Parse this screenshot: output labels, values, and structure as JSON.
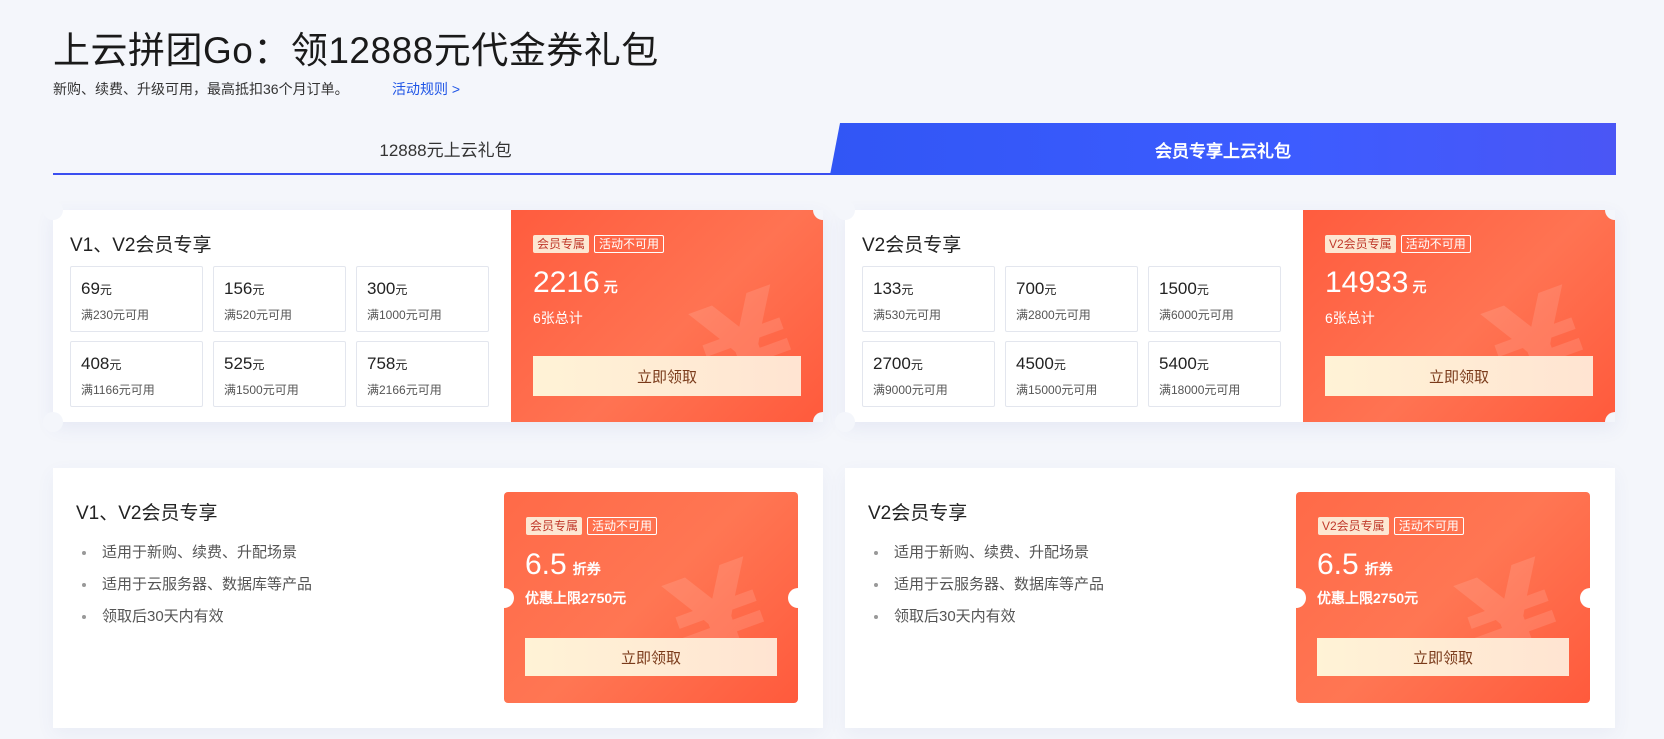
{
  "header": {
    "title": "上云拼团Go：领12888元代金券礼包",
    "subtitle": "新购、续费、升级可用，最高抵扣36个月订单。",
    "rules_link": "活动规则 >"
  },
  "tabs": [
    {
      "label": "12888元上云礼包",
      "active": false
    },
    {
      "label": "会员专享上云礼包",
      "active": true
    }
  ],
  "packages": [
    {
      "name": "V1、V2会员专享",
      "coupons": [
        {
          "amount": "69",
          "unit": "元",
          "condition": "满230元可用"
        },
        {
          "amount": "156",
          "unit": "元",
          "condition": "满520元可用"
        },
        {
          "amount": "300",
          "unit": "元",
          "condition": "满1000元可用"
        },
        {
          "amount": "408",
          "unit": "元",
          "condition": "满1166元可用"
        },
        {
          "amount": "525",
          "unit": "元",
          "condition": "满1500元可用"
        },
        {
          "amount": "758",
          "unit": "元",
          "condition": "满2166元可用"
        }
      ],
      "badge_fill": "会员专属",
      "badge_outline": "活动不可用",
      "total": "2216",
      "total_unit": "元",
      "total_note": "6张总计",
      "button": "立即领取"
    },
    {
      "name": "V2会员专享",
      "coupons": [
        {
          "amount": "133",
          "unit": "元",
          "condition": "满530元可用"
        },
        {
          "amount": "700",
          "unit": "元",
          "condition": "满2800元可用"
        },
        {
          "amount": "1500",
          "unit": "元",
          "condition": "满6000元可用"
        },
        {
          "amount": "2700",
          "unit": "元",
          "condition": "满9000元可用"
        },
        {
          "amount": "4500",
          "unit": "元",
          "condition": "满15000元可用"
        },
        {
          "amount": "5400",
          "unit": "元",
          "condition": "满18000元可用"
        }
      ],
      "badge_fill": "V2会员专属",
      "badge_outline": "活动不可用",
      "total": "14933",
      "total_unit": "元",
      "total_note": "6张总计",
      "button": "立即领取"
    }
  ],
  "discounts": [
    {
      "name": "V1、V2会员专享",
      "features": [
        "适用于新购、续费、升配场景",
        "适用于云服务器、数据库等产品",
        "领取后30天内有效"
      ],
      "badge_fill": "会员专属",
      "badge_outline": "活动不可用",
      "rate": "6.5",
      "rate_unit": "折券",
      "limit": "优惠上限2750元",
      "button": "立即领取"
    },
    {
      "name": "V2会员专享",
      "features": [
        "适用于新购、续费、升配场景",
        "适用于云服务器、数据库等产品",
        "领取后30天内有效"
      ],
      "badge_fill": "V2会员专属",
      "badge_outline": "活动不可用",
      "rate": "6.5",
      "rate_unit": "折券",
      "limit": "优惠上限2750元",
      "button": "立即领取"
    }
  ],
  "icons": {
    "watermark": "yen-icon"
  },
  "colors": {
    "accent_blue": "#3d5cff",
    "coupon_red": "#ff5c3e",
    "link": "#1f55e6"
  }
}
